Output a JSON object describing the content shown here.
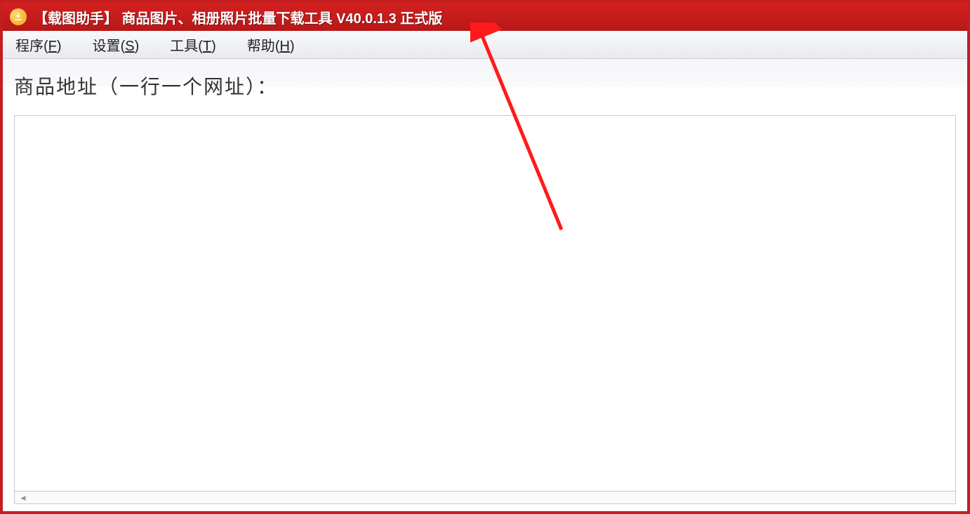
{
  "window": {
    "title": "【载图助手】 商品图片、相册照片批量下载工具 V40.0.1.3 正式版",
    "icon_name": "download-icon"
  },
  "menubar": {
    "items": [
      {
        "label": "程序",
        "accelerator": "F"
      },
      {
        "label": "设置",
        "accelerator": "S"
      },
      {
        "label": "工具",
        "accelerator": "T"
      },
      {
        "label": "帮助",
        "accelerator": "H"
      }
    ]
  },
  "main": {
    "section_label": "商品地址（一行一个网址）：",
    "url_input_value": ""
  },
  "colors": {
    "titlebar_bg": "#c41e1e",
    "accent": "#ff3b30"
  }
}
